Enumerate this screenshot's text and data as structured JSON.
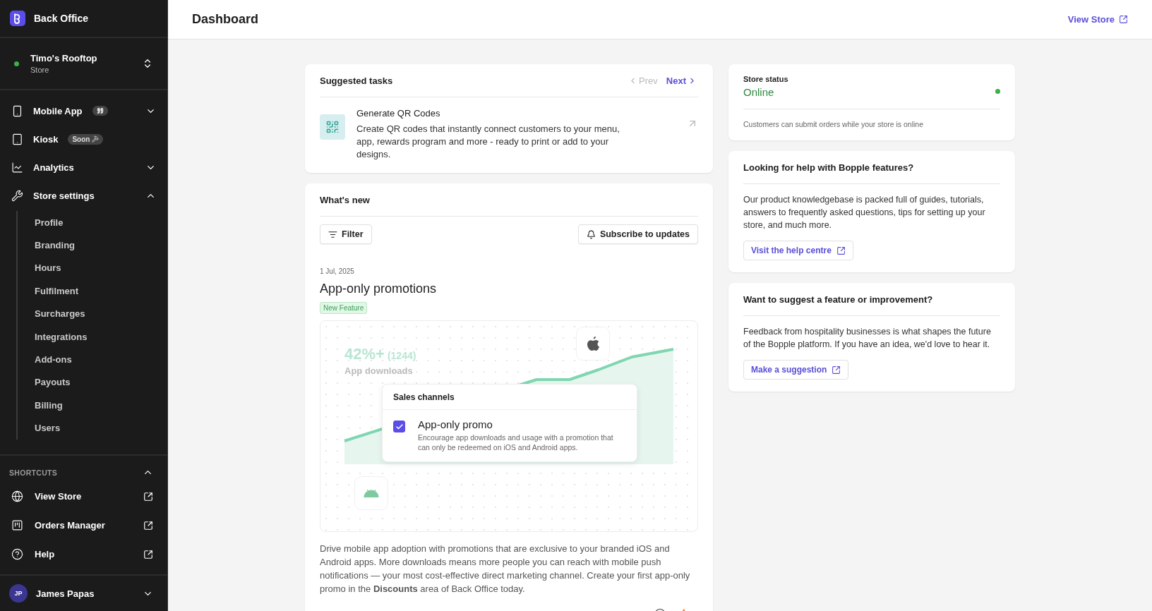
{
  "sidebar": {
    "brand": "Back Office",
    "store": {
      "name": "Timo's Rooftop",
      "type": "Store",
      "online": true
    },
    "nav": [
      {
        "label": "Mobile App",
        "badge": {
          "kind": "quote"
        },
        "expanded": false
      },
      {
        "label": "Kiosk",
        "badge": {
          "kind": "soon",
          "text": "Soon"
        }
      },
      {
        "label": "Analytics",
        "expanded": false
      },
      {
        "label": "Store settings",
        "expanded": true,
        "children": [
          {
            "label": "Profile"
          },
          {
            "label": "Branding"
          },
          {
            "label": "Hours"
          },
          {
            "label": "Fulfilment"
          },
          {
            "label": "Surcharges"
          },
          {
            "label": "Integrations"
          },
          {
            "label": "Add-ons"
          },
          {
            "label": "Payouts"
          },
          {
            "label": "Billing"
          },
          {
            "label": "Users"
          }
        ]
      }
    ],
    "shortcuts": {
      "title": "SHORTCUTS",
      "expanded": true,
      "items": [
        {
          "label": "View Store"
        },
        {
          "label": "Orders Manager"
        },
        {
          "label": "Help"
        }
      ]
    },
    "user": {
      "initials": "JP",
      "name": "James Papas"
    }
  },
  "header": {
    "title": "Dashboard",
    "link": "View Store"
  },
  "suggested_tasks": {
    "title": "Suggested tasks",
    "prev": {
      "label": "Prev",
      "disabled": true
    },
    "next": {
      "label": "Next",
      "disabled": false
    },
    "task": {
      "title": "Generate QR Codes",
      "description": "Create QR codes that instantly connect customers to your menu, app, rewards program and more - ready to print or add to your designs."
    }
  },
  "whats_new": {
    "title": "What's new",
    "filter": "Filter",
    "subscribe": "Subscribe to updates",
    "post": {
      "date": "1 Jul, 2025",
      "title": "App-only promotions",
      "tag": "New Feature",
      "illustration": {
        "stat": "42%+",
        "count": "(1244)",
        "stat_label": "App downloads",
        "popup_title": "Sales channels",
        "option": {
          "label": "App-only promo",
          "checked": true,
          "description": "Encourage app downloads and usage with a promotion that can only be redeemed on iOS and Android apps."
        }
      },
      "body": "Drive mobile app adoption with promotions that are exclusive to your branded iOS and Android apps. More downloads means more people you can reach with mobile push notifications — your most cost-effective direct marketing channel. Create your first app-only promo in the **Discounts** area of Back Office today."
    }
  },
  "store_status": {
    "title": "Store status",
    "status": "Online",
    "online": true,
    "note": "Customers can submit orders while your store is online"
  },
  "help_cards": [
    {
      "title": "Looking for help with Bopple features?",
      "text": "Our product knowledgebase is packed full of guides, tutorials, answers to frequently asked questions, tips for setting up your store, and much more.",
      "button": "Visit the help centre"
    },
    {
      "title": "Want to suggest a feature or improvement?",
      "text": "Feedback from hospitality businesses is what shapes the future of the Bopple platform. If you have an idea, we'd love to hear it.",
      "button": "Make a suggestion"
    }
  ]
}
